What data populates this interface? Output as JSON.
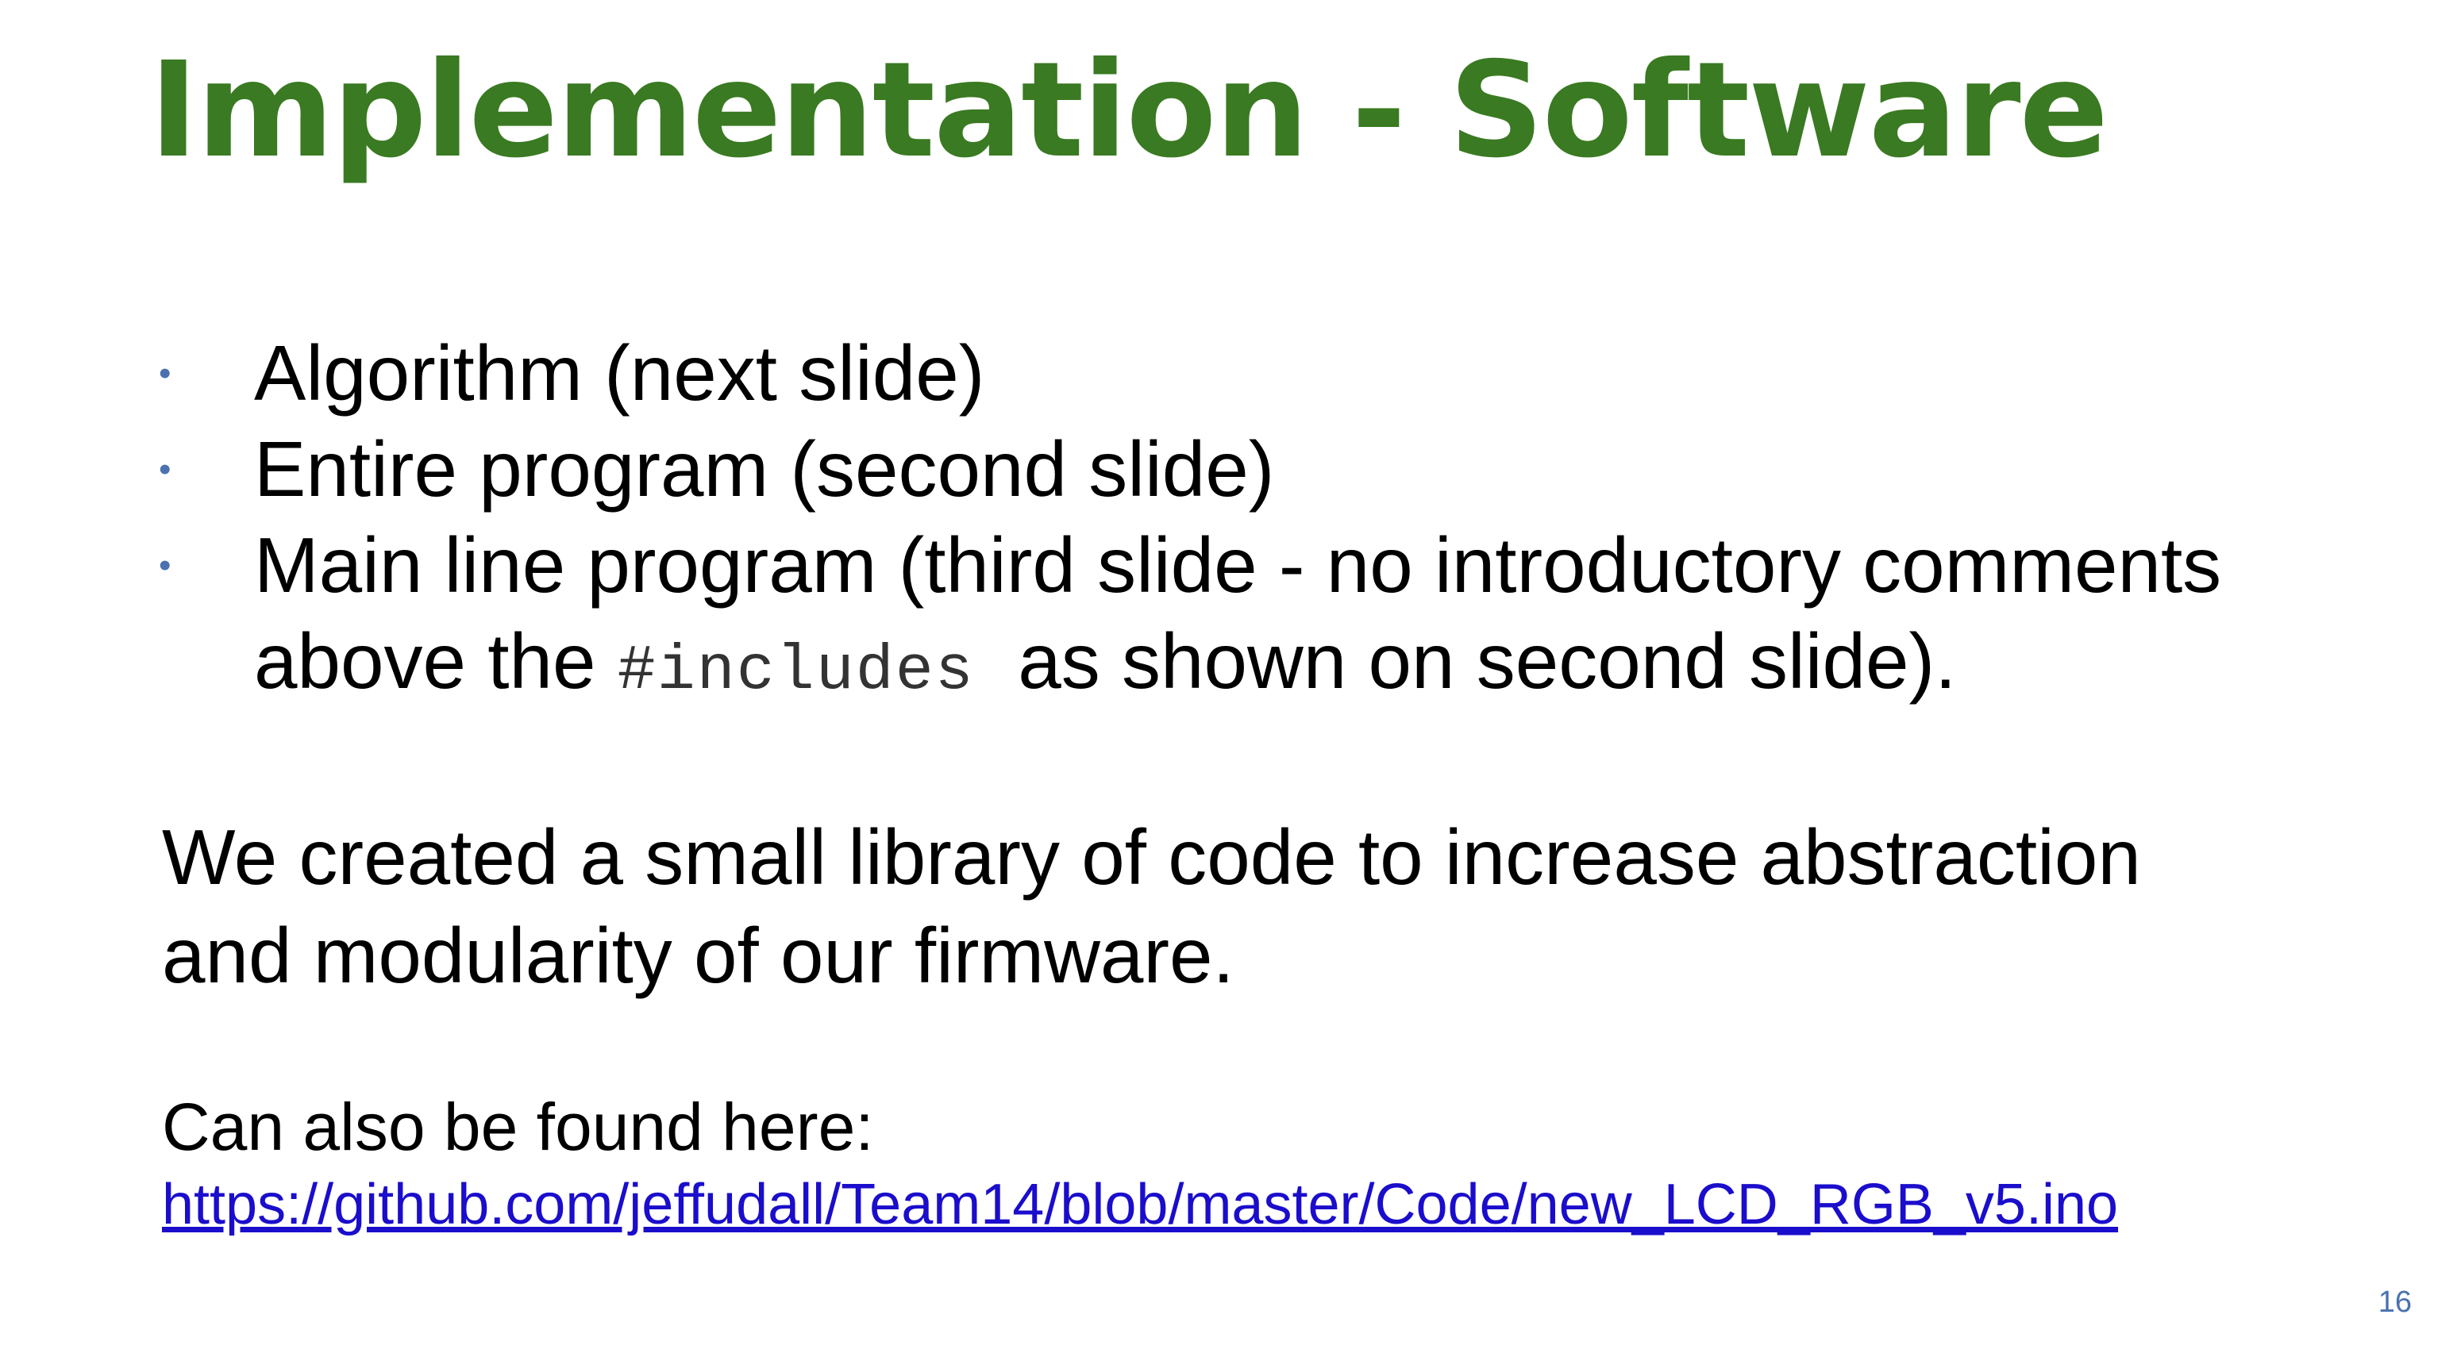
{
  "slide": {
    "title": "Implementation - Software",
    "bullets": [
      {
        "text": "Algorithm (next slide)"
      },
      {
        "text": "Entire program (second slide)"
      },
      {
        "text": "Main line program (third slide - no introductory comments"
      },
      {
        "before": "above the ",
        "code": "#includes",
        "after": "  as shown on second slide)."
      }
    ],
    "bullet_glyph": "•",
    "paragraph_line1": "We created a small library of code to increase abstraction",
    "paragraph_line2": "and modularity of our firmware.",
    "also_found_label": "Can also be found here:",
    "link_url": "https://github.com/jeffudall/Team14/blob/master/Code/new_LCD_RGB_v5.ino",
    "page_number": "16"
  },
  "colors": {
    "title": "#3a7a22",
    "bullet": "#4a72b0",
    "link": "#1a0dcc",
    "page_number": "#4a72b0",
    "text": "#000000",
    "background": "#ffffff"
  }
}
